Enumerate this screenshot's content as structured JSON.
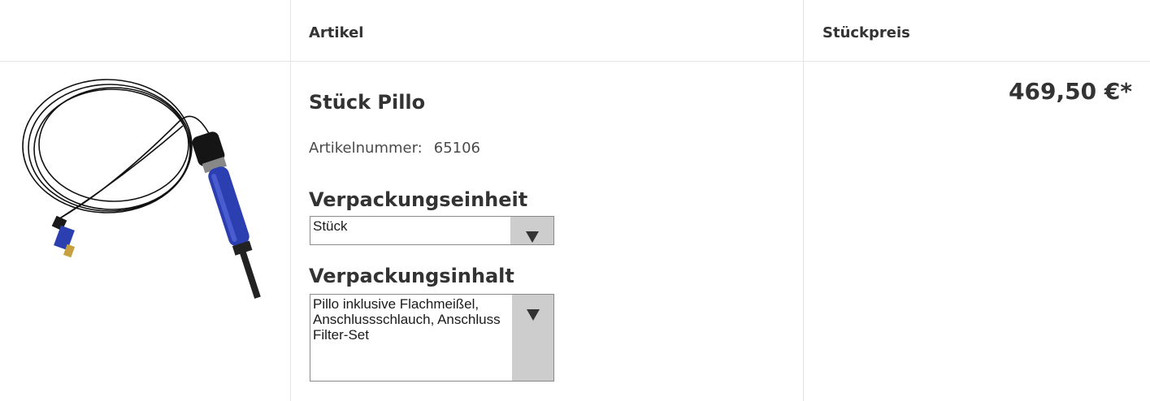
{
  "table": {
    "header": {
      "article_label": "Artikel",
      "unit_price_label": "Stückpreis"
    }
  },
  "product": {
    "title": "Stück Pillo",
    "article_number_label": "Artikelnummer:",
    "article_number": "65106",
    "price": "469,50 €*",
    "packaging_unit": {
      "label": "Verpackungseinheit",
      "selected": "Stück"
    },
    "packaging_content": {
      "label": "Verpackungsinhalt",
      "selected": "Pillo inklusive Flachmeißel, Anschlussschlauch, Anschluss Filter-Set"
    }
  },
  "colors": {
    "grip_blue": "#2b3fb0",
    "text": "#333333",
    "border": "#e4e4e4",
    "select_arrow_bg": "#cdcdcd"
  }
}
